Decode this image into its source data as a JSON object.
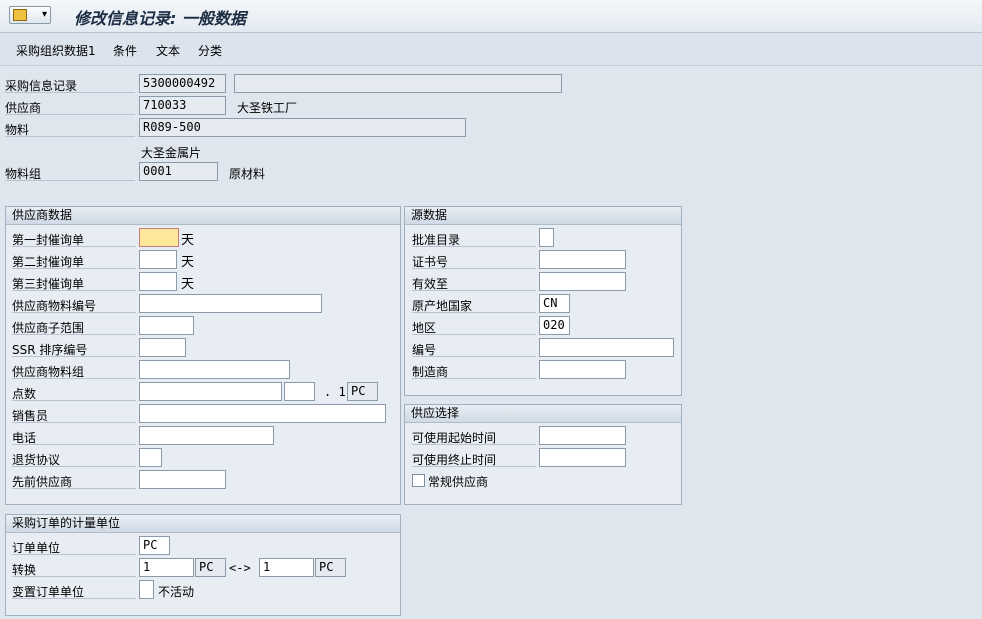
{
  "header": {
    "title": "修改信息记录: 一般数据"
  },
  "toolbar": {
    "items": [
      "采购组织数据1",
      "条件",
      "文本",
      "分类"
    ]
  },
  "general": {
    "info_record_label": "采购信息记录",
    "info_record_value": "5300000492",
    "info_record_desc": "",
    "vendor_label": "供应商",
    "vendor_value": "710033",
    "vendor_name": "大圣铁工厂",
    "material_label": "物料",
    "material_value": "R089-500",
    "material_desc": "大圣金属片",
    "matgroup_label": "物料组",
    "matgroup_value": "0001",
    "matgroup_desc": "原材料"
  },
  "vendor_data": {
    "title": "供应商数据",
    "reminder1": "第一封催询单",
    "reminder2": "第二封催询单",
    "reminder3": "第三封催询单",
    "day_unit": "天",
    "vendor_mat_no": "供应商物料编号",
    "vendor_subrange": "供应商子范围",
    "ssr_seq": "SSR 排序编号",
    "vendor_mat_group": "供应商物料组",
    "points": "点数",
    "points_sep": ". 1",
    "points_unit": "PC",
    "salesperson": "销售员",
    "phone": "电话",
    "return_agreement": "退货协议",
    "prior_vendor": "先前供应商"
  },
  "origin_data": {
    "title": "源数据",
    "approved_list": "批准目录",
    "certificate_no": "证书号",
    "valid_to": "有效至",
    "origin_country": "原产地国家",
    "origin_country_value": "CN",
    "region": "地区",
    "region_value": "020",
    "number": "编号",
    "manufacturer": "制造商"
  },
  "supply_option": {
    "title": "供应选择",
    "avail_from": "可使用起始时间",
    "avail_to": "可使用终止时间",
    "regular_vendor": "常规供应商"
  },
  "po_unit": {
    "title": "采购订单的计量单位",
    "order_unit": "订单单位",
    "order_unit_value": "PC",
    "conversion": "转换",
    "conv_left": "1",
    "conv_left_unit": "PC",
    "conv_arrow": "<->",
    "conv_right": "1",
    "conv_right_unit": "PC",
    "var_order_unit": "变置订单单位",
    "inactive": "不活动"
  }
}
